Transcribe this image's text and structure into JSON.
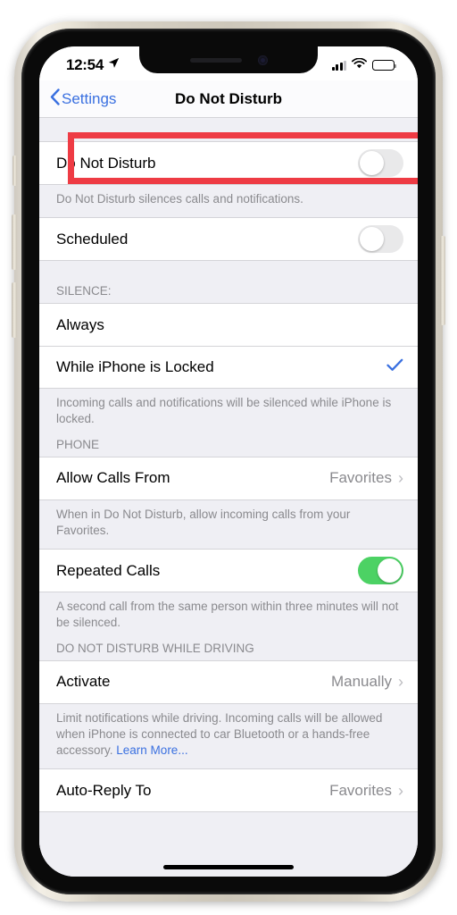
{
  "status_bar": {
    "time": "12:54",
    "location_icon": "location-arrow-icon",
    "signal_icon": "cellular-signal-icon",
    "signal_bars_filled": 3,
    "signal_bars_total": 4,
    "wifi_icon": "wifi-icon",
    "battery_icon": "battery-full-icon"
  },
  "nav_bar": {
    "back_label": "Settings",
    "back_icon": "chevron-left-icon",
    "title": "Do Not Disturb"
  },
  "sections": {
    "dnd": {
      "row_label": "Do Not Disturb",
      "toggle_state": "off",
      "footer": "Do Not Disturb silences calls and notifications."
    },
    "scheduled": {
      "row_label": "Scheduled",
      "toggle_state": "off"
    },
    "silence": {
      "header": "SILENCE:",
      "options": [
        {
          "label": "Always",
          "selected": false
        },
        {
          "label": "While iPhone is Locked",
          "selected": true
        }
      ],
      "footer": "Incoming calls and notifications will be silenced while iPhone is locked."
    },
    "phone": {
      "header": "PHONE",
      "allow_calls": {
        "label": "Allow Calls From",
        "value": "Favorites",
        "chevron": "chevron-right-icon"
      },
      "allow_calls_footer": "When in Do Not Disturb, allow incoming calls from your Favorites.",
      "repeated_calls": {
        "label": "Repeated Calls",
        "toggle_state": "on"
      },
      "repeated_calls_footer": "A second call from the same person within three minutes will not be silenced."
    },
    "driving": {
      "header": "DO NOT DISTURB WHILE DRIVING",
      "activate": {
        "label": "Activate",
        "value": "Manually",
        "chevron": "chevron-right-icon"
      },
      "footer_text": "Limit notifications while driving. Incoming calls will be allowed when iPhone is connected to car Bluetooth or a hands-free accessory. ",
      "footer_link": "Learn More...",
      "auto_reply": {
        "label": "Auto-Reply To",
        "value": "Favorites",
        "chevron": "chevron-right-icon"
      }
    }
  },
  "annotation": {
    "target": "Do Not Disturb",
    "color": "#ee3b44"
  },
  "colors": {
    "accent_blue": "#3a70e0",
    "toggle_on_green": "#4cd264",
    "toggle_off_gray": "#e9e9ea",
    "secondary_text": "#8a8a8e",
    "group_background": "#efeff4",
    "highlight_red": "#ee3b44"
  },
  "glyphs": {
    "chevron_left": "‹",
    "chevron_right": "›",
    "check": "✓"
  }
}
